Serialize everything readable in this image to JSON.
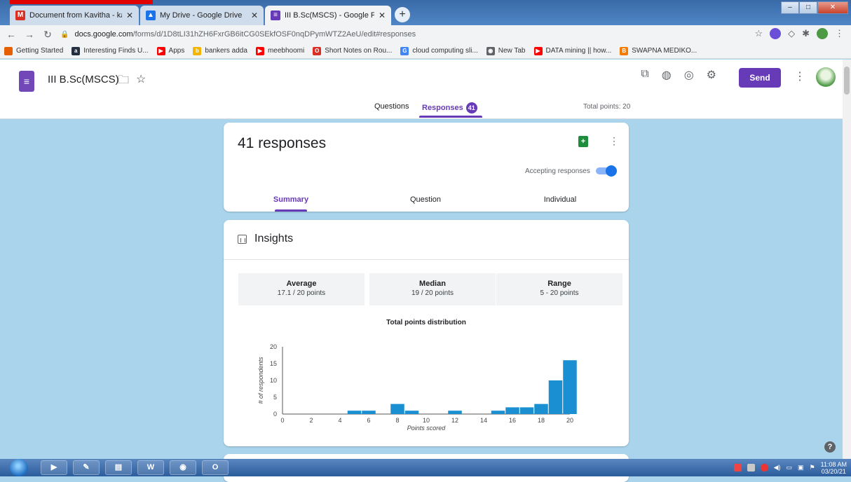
{
  "browser": {
    "tabs": [
      {
        "label": "Document from Kavitha - kavitha",
        "icon": "gmail-icon",
        "color": "#d93025"
      },
      {
        "label": "My Drive - Google Drive",
        "icon": "drive-icon",
        "color": "#1a73e8"
      },
      {
        "label": "III B.Sc(MSCS) - Google Forms",
        "icon": "forms-icon",
        "color": "#673ab7"
      }
    ],
    "new_tab": "+",
    "url_domain": "docs.google.com",
    "url_path": "/forms/d/1D8tLI31hZH6FxrGB6itCG0SEkfOSF0nqDPymWTZ2AeU/edit#responses",
    "bookmarks": [
      {
        "label": "Getting Started",
        "icon": "firefox-icon",
        "color": "#e66000"
      },
      {
        "label": "Interesting Finds U...",
        "icon": "amazon-icon",
        "color": "#232f3e"
      },
      {
        "label": "Apps",
        "icon": "youtube-icon",
        "color": "#ff0000"
      },
      {
        "label": "bankers adda",
        "icon": "bankersadda-icon",
        "color": "#f4b400"
      },
      {
        "label": "meebhoomi",
        "icon": "youtube-icon",
        "color": "#ff0000"
      },
      {
        "label": "Short Notes on Rou...",
        "icon": "opera-icon",
        "color": "#d93025"
      },
      {
        "label": "cloud computing sli...",
        "icon": "google-icon",
        "color": "#4285f4"
      },
      {
        "label": "New Tab",
        "icon": "chrome-icon",
        "color": "#5f6368"
      },
      {
        "label": "DATA mining || how...",
        "icon": "youtube-icon",
        "color": "#ff0000"
      },
      {
        "label": "SWAPNA MEDIKO...",
        "icon": "blogger-icon",
        "color": "#f57c00"
      }
    ]
  },
  "form": {
    "title": "III B.Sc(MSCS)",
    "send_label": "Send",
    "tab_questions": "Questions",
    "tab_responses": "Responses",
    "responses_badge": "41",
    "total_points": "Total points: 20",
    "accent": "#673ab7",
    "background": "#a9d4ec"
  },
  "responses_card": {
    "count_label": "41 responses",
    "accepting_label": "Accepting responses",
    "accepting": true,
    "subtabs": [
      "Summary",
      "Question",
      "Individual"
    ],
    "active_subtab": "Summary"
  },
  "insights": {
    "title": "Insights",
    "stats": [
      {
        "label": "Average",
        "value": "17.1 / 20 points"
      },
      {
        "label": "Median",
        "value": "19 / 20 points"
      },
      {
        "label": "Range",
        "value": "5 - 20 points"
      }
    ]
  },
  "chart_data": {
    "type": "bar",
    "title": "Total points distribution",
    "xlabel": "Points scored",
    "ylabel": "# of respondents",
    "x": [
      5,
      6,
      8,
      9,
      12,
      15,
      16,
      17,
      18,
      19,
      20
    ],
    "values": [
      1,
      1,
      3,
      1,
      1,
      1,
      2,
      2,
      3,
      10,
      16
    ],
    "xlim": [
      0,
      20
    ],
    "ylim": [
      0,
      20
    ],
    "xticks": [
      0,
      2,
      4,
      6,
      8,
      10,
      12,
      14,
      16,
      18,
      20
    ],
    "yticks": [
      0,
      5,
      10,
      15,
      20
    ],
    "bar_color": "#1a8fd1",
    "grid": false
  },
  "taskbar": {
    "clock_time": "11:08 AM",
    "clock_date": "03/20/21"
  }
}
